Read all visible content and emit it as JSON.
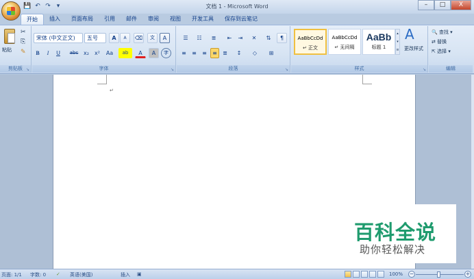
{
  "window": {
    "title": "文档 1 - Microsoft Word",
    "minimize": "–",
    "maximize": "□",
    "close": "X"
  },
  "qat": {
    "save_icon": "save-icon",
    "undo_icon": "undo-icon",
    "redo_icon": "redo-icon"
  },
  "tabs": [
    {
      "label": "开始",
      "active": true
    },
    {
      "label": "插入"
    },
    {
      "label": "页面布局"
    },
    {
      "label": "引用"
    },
    {
      "label": "邮件"
    },
    {
      "label": "审阅"
    },
    {
      "label": "视图"
    },
    {
      "label": "开发工具"
    },
    {
      "label": "保存到云笔记"
    }
  ],
  "ribbon": {
    "clipboard": {
      "label": "剪贴板",
      "paste": "粘贴"
    },
    "font": {
      "label": "字体",
      "font_name": "宋体 (中文正文)",
      "font_size": "五号",
      "grow": "A",
      "shrink": "A",
      "bold": "B",
      "italic": "I",
      "underline": "U",
      "strike": "abc",
      "subscript": "x₂",
      "superscript": "x²",
      "case": "Aa",
      "highlight": "ab",
      "color": "A",
      "charborder": "A",
      "enclose": "字"
    },
    "paragraph": {
      "label": "段落"
    },
    "styles": {
      "label": "样式",
      "items": [
        {
          "sample": "AaBbCcDd",
          "name": "↵ 正文"
        },
        {
          "sample": "AaBbCcDd",
          "name": "↵ 无间隔"
        },
        {
          "sample": "AaBb",
          "name": "标题 1"
        }
      ],
      "change_styles": "更改样式"
    },
    "editing": {
      "label": "编辑",
      "find": "查找",
      "replace": "替换",
      "select": "选择"
    }
  },
  "document": {
    "paragraph_mark": "↵"
  },
  "watermark": {
    "title": "百科全说",
    "subtitle": "助你轻松解决"
  },
  "status": {
    "page": "页面: 1/1",
    "words": "字数: 0",
    "language": "英语(美国)",
    "mode": "插入",
    "zoom": "100%",
    "zoom_minus": "−",
    "zoom_plus": "+"
  }
}
